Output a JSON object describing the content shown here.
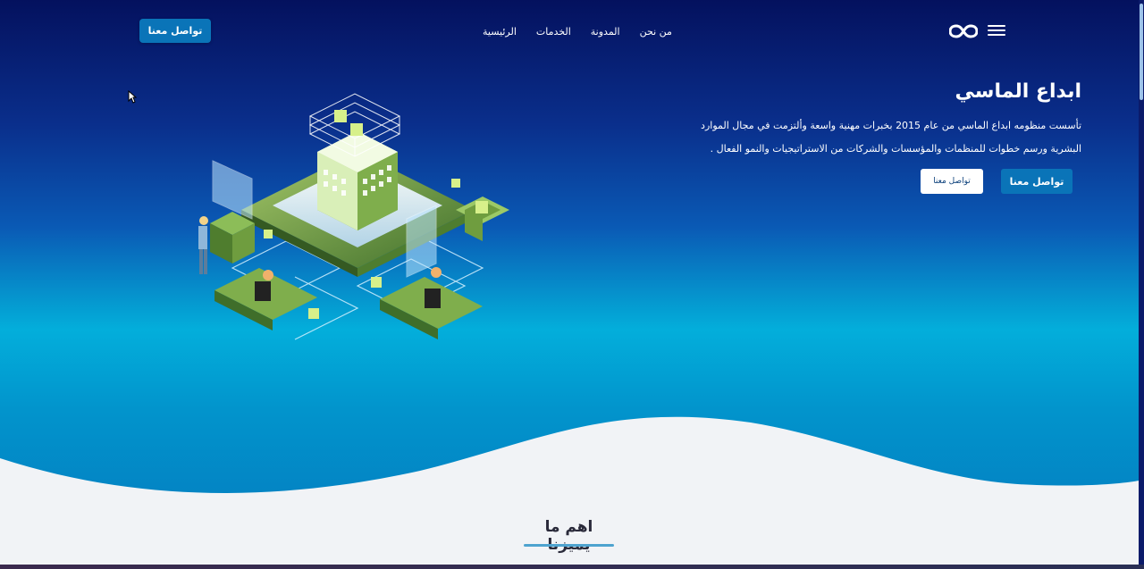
{
  "navbar": {
    "contact_button": "تواصل معنا",
    "links": [
      "الرئيسية",
      "الخدمات",
      "المدونة",
      "من نحن"
    ],
    "menu_icon": "hamburger-icon",
    "logo_icon": "infinity-logo-icon"
  },
  "hero": {
    "title": "ابداع الماسي",
    "description": "تأسست منظومه ابداع الماسي من عام 2015 بخبرات مهنية واسعة وألتزمت في مجال الموارد البشرية ورسم خطوات للمنظمات والمؤسسات والشركات من الاستراتيجيات والنمو الفعال .",
    "primary_button": "تواصل معنا",
    "secondary_button": "تواصل معنا",
    "illustration_icon": "isometric-tech-building-illustration"
  },
  "features": {
    "heading": "اهم ما يميزنا"
  },
  "colors": {
    "accent": "#0a74b8",
    "underline": "#4ea3cf",
    "hero_top": "#04115e",
    "hero_mid": "#03aedb"
  }
}
